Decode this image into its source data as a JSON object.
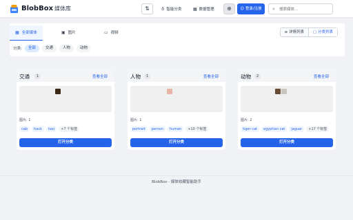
{
  "header": {
    "brand": "BlobBox",
    "brand_sub": "媒体库",
    "nav": [
      {
        "icon": "lightbulb-icon",
        "label": "智能分类"
      },
      {
        "icon": "grid-icon",
        "label": "数据管理"
      }
    ],
    "login_label": "登录/注册",
    "search_placeholder": "搜索媒体..."
  },
  "tabs": [
    {
      "label": "全部媒体",
      "active": true
    },
    {
      "label": "图片",
      "active": false
    },
    {
      "label": "视频",
      "active": false
    }
  ],
  "view_toggle": {
    "detail": "详情列表",
    "category": "分类列表"
  },
  "filter": {
    "label": "分类:",
    "chips": [
      "全部",
      "交通",
      "人物",
      "动物"
    ]
  },
  "cards": [
    {
      "title": "交通",
      "count": "1",
      "link": "查看全部",
      "image_count": "图片: 1",
      "tags": [
        "cab",
        "hack",
        "taxi"
      ],
      "more": "+7 个标签",
      "button": "打开分类",
      "thumbs": [
        "#3b2a18"
      ]
    },
    {
      "title": "人物",
      "count": "1",
      "link": "查看全部",
      "image_count": "图片: 1",
      "tags": [
        "portrait",
        "person",
        "human"
      ],
      "more": "+10 个标签",
      "button": "打开分类",
      "thumbs": [
        "#e8b4a6"
      ]
    },
    {
      "title": "动物",
      "count": "2",
      "link": "查看全部",
      "image_count": "图片: 2",
      "tags": [
        "tiger cat",
        "egyptian cat",
        "jaguar"
      ],
      "more": "+17 个标签",
      "button": "打开分类",
      "thumbs": [
        "#6b4a32",
        "#c9c4bd"
      ]
    }
  ],
  "footer": "BlobBox - 媒体收藏智能助手",
  "colors": {
    "accent": "#2563eb",
    "background": "#f1f2f5"
  }
}
